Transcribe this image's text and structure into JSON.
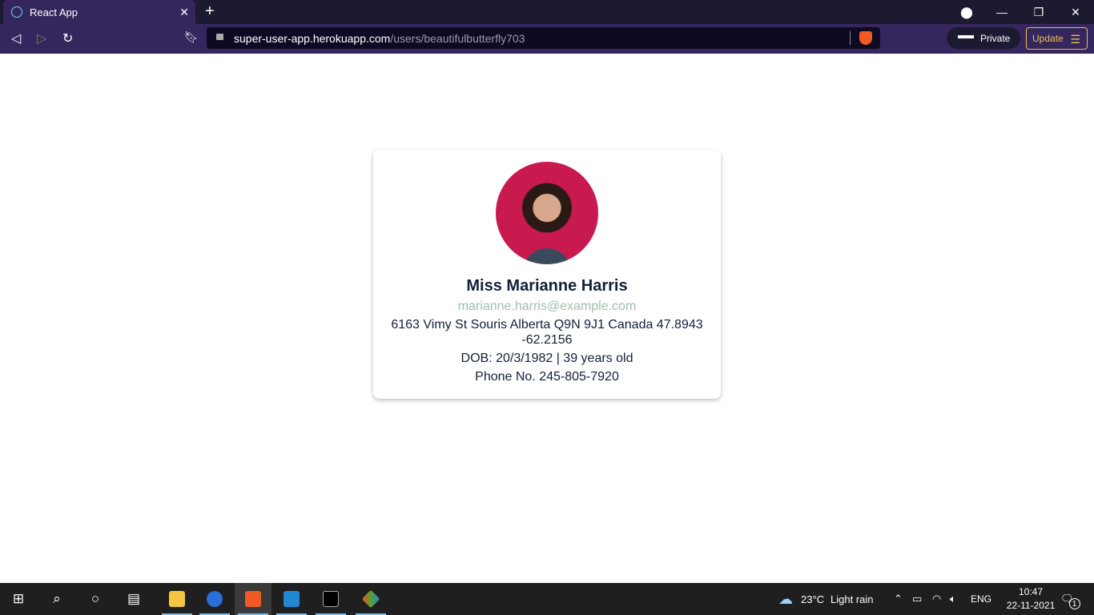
{
  "browser": {
    "tab_title": "React App",
    "url_host": "super-user-app.herokuapp.com",
    "url_path": "/users/beautifulbutterfly703",
    "private_label": "Private",
    "update_label": "Update",
    "colors": {
      "tabbar": "#1c1a30",
      "toolbar": "#35275e",
      "update": "#e5c34f"
    }
  },
  "profile": {
    "name": "Miss Marianne Harris",
    "email": "marianne.harris@example.com",
    "address": "6163 Vimy St Souris Alberta Q9N 9J1 Canada 47.8943 -62.2156",
    "dob": "DOB: 20/3/1982 | 39 years old",
    "phone": "Phone No. 245-805-7920",
    "email_color": "#9fc1aa"
  },
  "taskbar": {
    "apps": [
      "start",
      "search",
      "cortana",
      "task-view",
      "file-explorer",
      "firefox",
      "brave",
      "vscode",
      "terminal",
      "git"
    ],
    "weather": "23°C",
    "weather_desc": "Light rain",
    "language": "ENG",
    "time": "10:47",
    "date": "22-11-2021",
    "notifications": "1"
  }
}
